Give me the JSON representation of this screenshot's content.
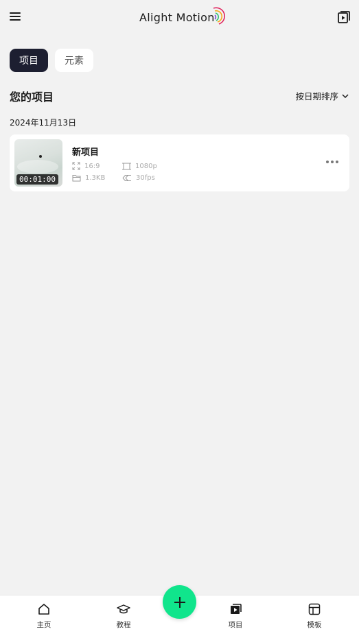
{
  "app": {
    "title": "Alight Motion"
  },
  "header": {
    "menu_icon": "hamburger-menu-icon",
    "export_icon": "media-library-icon"
  },
  "tabs": [
    {
      "label": "项目",
      "active": true
    },
    {
      "label": "元素",
      "active": false
    }
  ],
  "section": {
    "title": "您的项目",
    "sort_label": "按日期排序"
  },
  "groups": [
    {
      "date": "2024年11月13日",
      "projects": [
        {
          "name": "新项目",
          "duration": "00:01:00",
          "aspect_ratio": "16:9",
          "resolution": "1080p",
          "size": "1.3KB",
          "fps": "30fps"
        }
      ]
    }
  ],
  "bottom_nav": [
    {
      "label": "主页",
      "icon": "home-icon"
    },
    {
      "label": "教程",
      "icon": "graduation-cap-icon"
    },
    {
      "label": "项目",
      "icon": "project-play-icon",
      "active": true
    },
    {
      "label": "模板",
      "icon": "template-layout-icon"
    }
  ],
  "fab": {
    "icon": "plus-icon"
  },
  "colors": {
    "accent": "#10e58c",
    "tab_active": "#1d1f31",
    "background": "#f2f2f2"
  }
}
